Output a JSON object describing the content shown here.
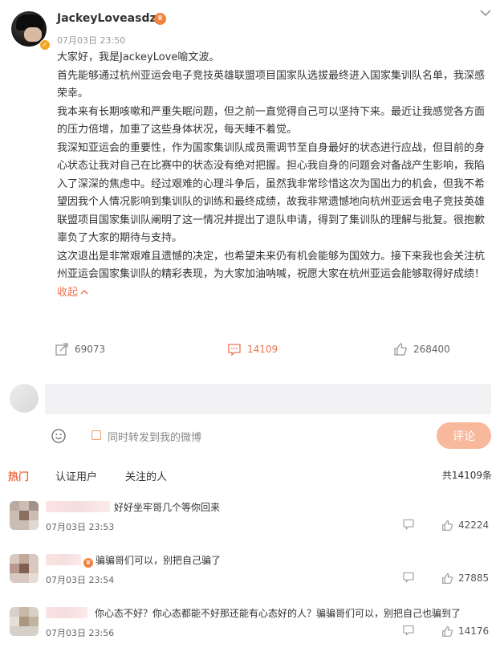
{
  "post": {
    "username": "JackeyLoveasdzz",
    "timestamp": "07月03日 23:50",
    "paragraphs": [
      "大家好，我是JackeyLove喻文波。",
      "首先能够通过杭州亚运会电子竞技英雄联盟项目国家队选拔最终进入国家集训队名单，我深感荣幸。",
      "我本来有长期咳嗽和严重失眠问题，但之前一直觉得自己可以坚持下来。最近让我感觉各方面的压力倍增，加重了这些身体状况，每天睡不着觉。",
      "我深知亚运会的重要性，作为国家集训队成员需调节至自身最好的状态进行应战，但目前的身心状态让我对自己在比赛中的状态没有绝对把握。担心我自身的问题会对备战产生影响，我陷入了深深的焦虑中。经过艰难的心理斗争后，虽然我非常珍惜这次为国出力的机会，但我不希望因我个人情况影响到集训队的训练和最终成绩，故我非常遗憾地向杭州亚运会电子竞技英雄联盟项目国家集训队阐明了这一情况并提出了退队申请，得到了集训队的理解与批复。很抱歉辜负了大家的期待与支持。"
    ],
    "last_paragraph": "这次退出是非常艰难且遗憾的决定，也希望未来仍有机会能够为国效力。接下来我也会关注杭州亚运会国家集训队的精彩表现，为大家加油呐喊，祝愿大家在杭州亚运会能够取得好成绩！",
    "collapse_label": "收起",
    "reposts": "69073",
    "comments": "14109",
    "likes": "268400"
  },
  "composer": {
    "placeholder": "",
    "checkbox_label": "同时转发到我的微博",
    "submit_label": "评论"
  },
  "tabs": {
    "hot": "热门",
    "verified": "认证用户",
    "followed": "关注的人",
    "total": "共14109条"
  },
  "comments": [
    {
      "text": "好好坐牢哥几个等你回来",
      "time": "07月03日 23:53",
      "likes": "42224"
    },
    {
      "text": "骗骗哥们可以，别把自己骗了",
      "time": "07月03日 23:54",
      "likes": "27885"
    },
    {
      "text": "你心态不好？你心态都能不好那还能有心态好的人？骗骗哥们可以，别把自己也骗到了",
      "time": "07月03日 23:56",
      "likes": "14176"
    }
  ],
  "colors": {
    "accent": "#eb7350",
    "submit_bg": "#f7b89c"
  }
}
